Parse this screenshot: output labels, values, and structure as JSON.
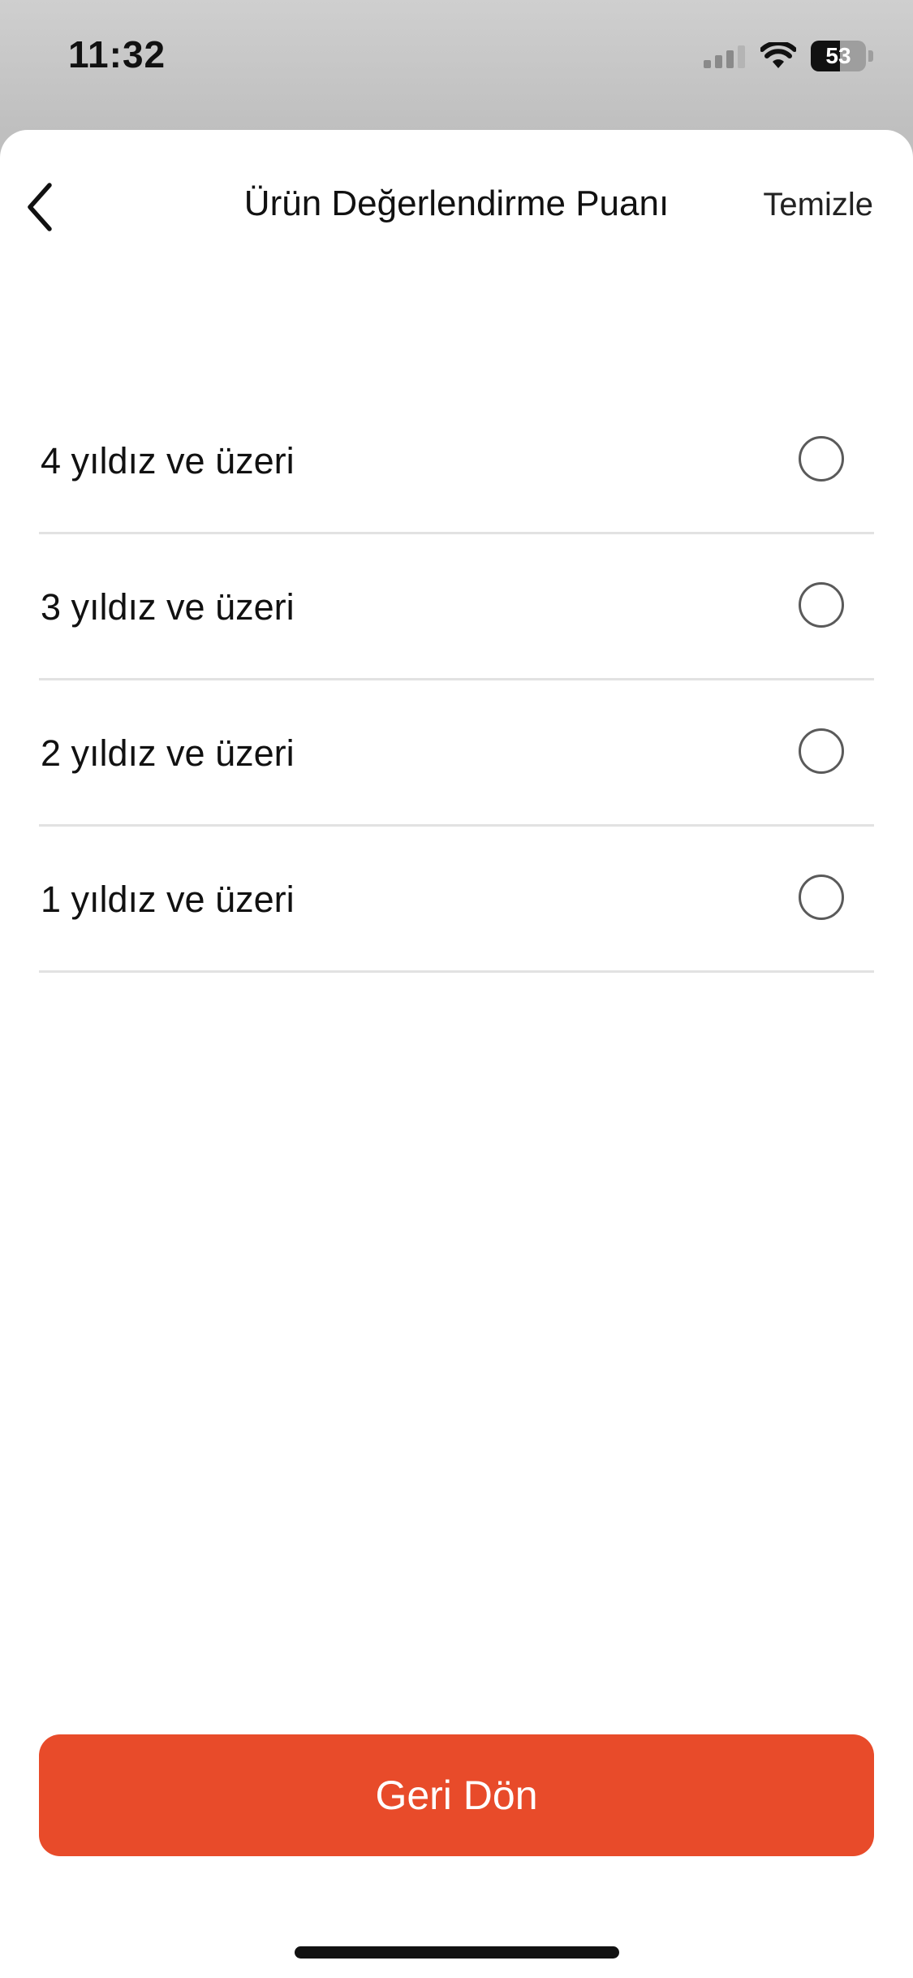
{
  "status_bar": {
    "time": "11:32",
    "battery_level": "53",
    "battery_fraction": 0.53,
    "icons": [
      "cellular-signal-icon",
      "wifi-icon",
      "battery-icon"
    ]
  },
  "header": {
    "back_icon": "chevron-left-icon",
    "title": "Ürün Değerlendirme Puanı",
    "clear_label": "Temizle"
  },
  "options": [
    {
      "label": "4 yıldız ve üzeri",
      "selected": false
    },
    {
      "label": "3 yıldız ve üzeri",
      "selected": false
    },
    {
      "label": "2 yıldız ve üzeri",
      "selected": false
    },
    {
      "label": "1 yıldız ve üzeri",
      "selected": false
    }
  ],
  "footer": {
    "primary_label": "Geri Dön"
  },
  "colors": {
    "accent": "#E84B2A",
    "divider": "#E2E2E2",
    "text": "#111111"
  }
}
